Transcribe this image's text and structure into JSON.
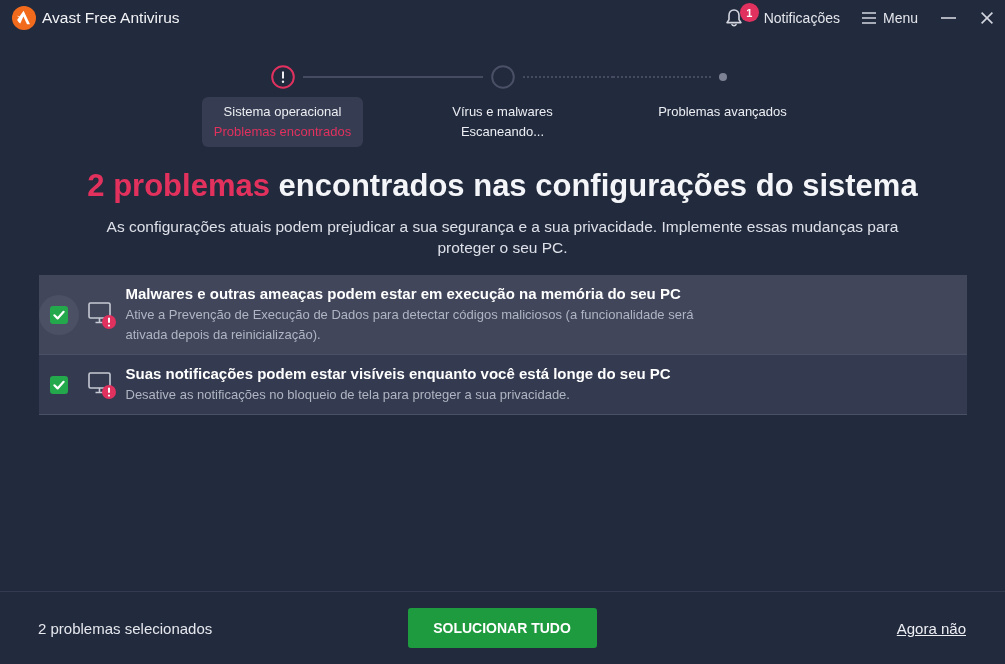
{
  "window": {
    "title": "Avast Free Antivirus"
  },
  "header": {
    "notifications": {
      "label": "Notificações",
      "count": "1"
    },
    "menu": {
      "label": "Menu"
    }
  },
  "steps": [
    {
      "title": "Sistema operacional",
      "status": "Problemas encontrados",
      "kind": "problems",
      "selected": true
    },
    {
      "title": "Vírus e malwares",
      "status": "Escaneando...",
      "kind": "scanning",
      "selected": false
    },
    {
      "title": "Problemas avançados",
      "kind": "pending",
      "selected": false
    }
  ],
  "heading": {
    "highlight": "2 problemas",
    "text": "encontrados nas configurações do sistema"
  },
  "subtitle": "As configurações atuais podem prejudicar a sua segurança e a sua privacidade. Implemente essas mudanças para proteger o seu PC.",
  "issues": [
    {
      "title": "Malwares e outras ameaças podem estar em execução na memória do seu PC",
      "description": "Ative a Prevenção de Execução de Dados para detectar códigos maliciosos (a funcionalidade será ativada depois da reinicialização).",
      "checked": true,
      "hovered": true
    },
    {
      "title": "Suas notificações podem estar visíveis enquanto você está longe do seu PC",
      "description": "Desative as notificações no bloqueio de tela para proteger a sua privacidade.",
      "checked": true,
      "hovered": false
    }
  ],
  "footer": {
    "selection": "2 problemas selecionados",
    "fix_button": "SOLUCIONAR TUDO",
    "dismiss_link": "Agora não"
  }
}
